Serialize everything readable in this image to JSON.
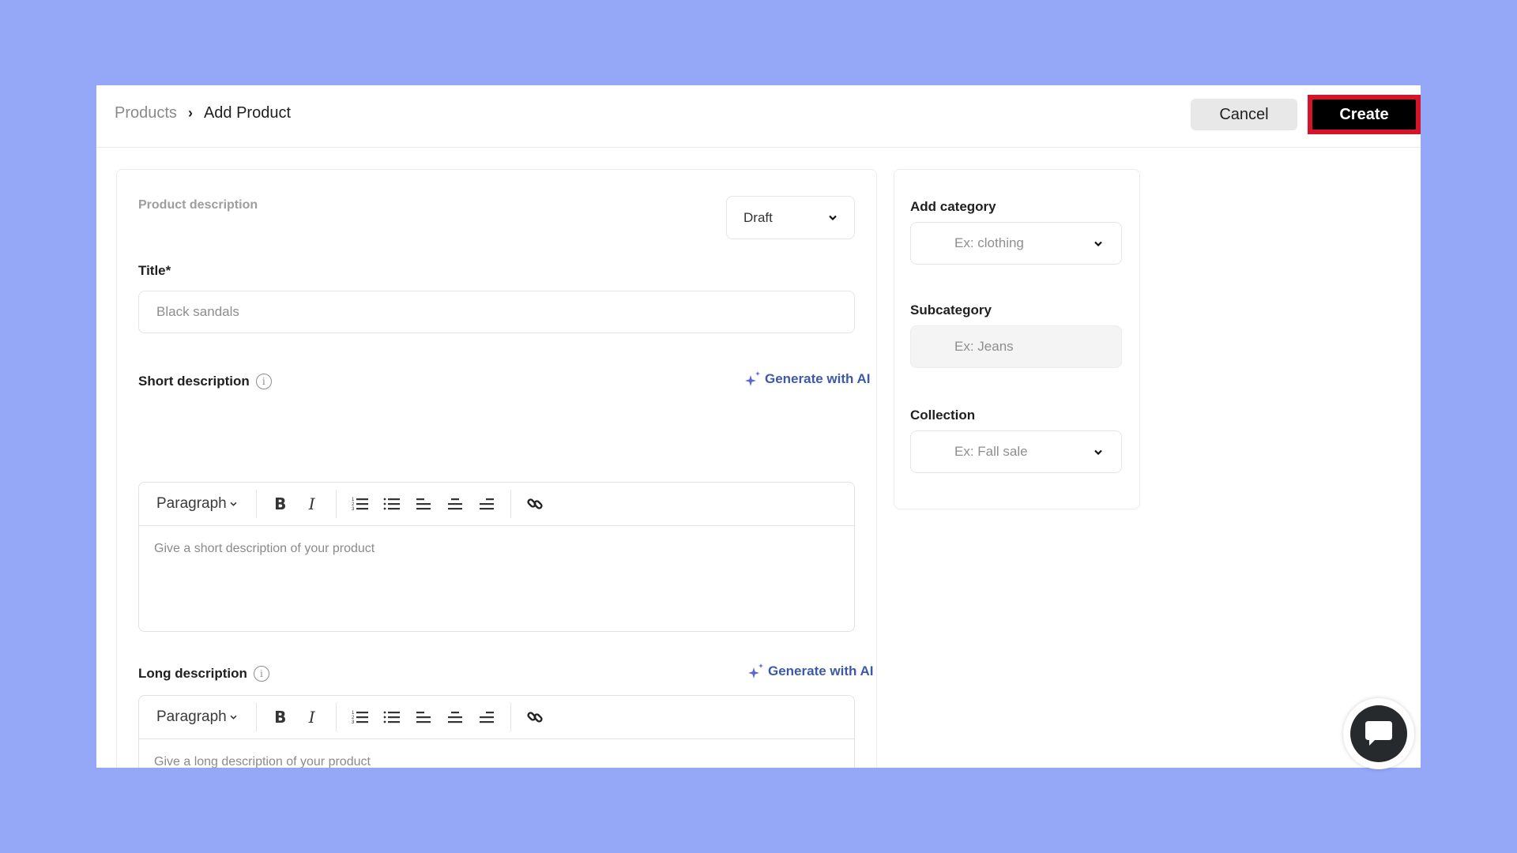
{
  "header": {
    "breadcrumb": {
      "parent": "Products",
      "separator_icon": "chevron-right-icon",
      "current": "Add Product"
    },
    "cancel_label": "Cancel",
    "create_label": "Create"
  },
  "main": {
    "section_title": "Product description",
    "status": {
      "selected": "Draft"
    },
    "title_field": {
      "label": "Title*",
      "value": "",
      "placeholder": "Black sandals"
    },
    "short_description": {
      "label": "Short description",
      "info_icon": "info-icon",
      "generate_label": "Generate with AI",
      "toolbar": {
        "paragraph": "Paragraph",
        "bold": "B",
        "italic": "I"
      },
      "placeholder": "Give a short description of your product"
    },
    "long_description": {
      "label": "Long description",
      "info_icon": "info-icon",
      "generate_label": "Generate with AI",
      "toolbar": {
        "paragraph": "Paragraph",
        "bold": "B",
        "italic": "I"
      },
      "placeholder": "Give a long description of your product"
    }
  },
  "sidebar": {
    "category": {
      "label": "Add category",
      "placeholder": "Ex: clothing"
    },
    "subcategory": {
      "label": "Subcategory",
      "placeholder": "Ex: Jeans"
    },
    "collection": {
      "label": "Collection",
      "placeholder": "Ex: Fall sale"
    }
  },
  "chat": {
    "icon": "chat-bubble-icon"
  },
  "colors": {
    "background": "#95a8f8",
    "create_button": "#000000",
    "create_highlight": "#d3142b",
    "ai_link": "#3d5aa8",
    "ai_sparkle": "#5b63d8"
  }
}
